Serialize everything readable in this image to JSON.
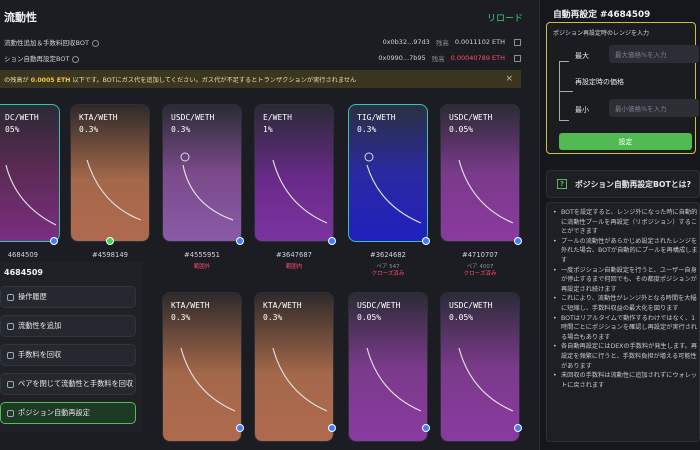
{
  "header": {
    "title": "流動性",
    "reload_label": "リロード"
  },
  "bots": [
    {
      "label": "流動性追加＆手数料回収BOT",
      "address": "0x0b32...97d3",
      "balance_label": "残高",
      "balance": "0.0011102 ETH"
    },
    {
      "label": "ション自動再設定BOT",
      "address": "0x0990...7b95",
      "balance_label": "残高",
      "balance": "0.00040789 ETH"
    }
  ],
  "warning": {
    "prefix": "の残高が ",
    "amount": "0.0005 ETH",
    "suffix": " 以下です。BOTにガス代を追加してください。ガス代が不足するとトランザクションが実行されません"
  },
  "cards_row1": [
    {
      "pair": "DC/WETH",
      "fee": "05%",
      "id": "4684509",
      "status": "",
      "selected": true
    },
    {
      "pair": "KTA/WETH",
      "fee": "0.3%",
      "id": "#4598149",
      "status": ""
    },
    {
      "pair": "USDC/WETH",
      "fee": "0.3%",
      "id": "#4555951",
      "status": "範囲外"
    },
    {
      "pair": "E/WETH",
      "fee": "1%",
      "id": "#3647687",
      "status": "範囲内"
    },
    {
      "pair": "TIG/WETH",
      "fee": "0.3%",
      "id": "#3624682",
      "status": "ペア 547"
    },
    {
      "pair": "USDC/WETH",
      "fee": "0.05%",
      "id": "#4710707",
      "status": "ペア 4007"
    }
  ],
  "cards_row1_extra": {
    "c4": "クローズ済み",
    "c5": "クローズ済み"
  },
  "cards_row2": [
    {
      "pair": "KTA/WETH",
      "fee": "0.3%"
    },
    {
      "pair": "KTA/WETH",
      "fee": "0.3%"
    },
    {
      "pair": "USDC/WETH",
      "fee": "0.05%"
    },
    {
      "pair": "USDC/WETH",
      "fee": "0.05%"
    }
  ],
  "menu": {
    "title": "4684509",
    "items": [
      "操作履歴",
      "流動性を追加",
      "手数料を回収",
      "ペアを閉じて流動性と手数料を回収",
      "ポジション自動再設定"
    ]
  },
  "settings": {
    "title": "自動再設定 #4684509",
    "caption": "ポジション再設定時のレンジを入力",
    "max_label": "最大",
    "max_placeholder": "最大価格%を入力",
    "current_label": "再設定時の価格",
    "min_label": "最小",
    "min_placeholder": "最小価格%を入力",
    "button": "設定"
  },
  "faq": {
    "title": "ポジション自動再設定BOTとは?",
    "items": [
      "BOTを設定すると、レンジ外になった時に自動的に流動性プールを再設定（リポジション）することができます",
      "プールの流動性があらかじめ設定されたレンジを外れた場合、BOTが自動的にプールを再構成します",
      "一度ポジション自動設定を行うと、ユーザー自身が停止するまで何回でも、その都度ポジションが再設定され続けます",
      "これにより、流動性がレンジ外となる時間を大幅に短縮し、手数料収益の最大化を図ります",
      "BOTはリアルタイムで動作するわけではなく、1時間ごとにポジションを確認し再設定が実行される場合もあります",
      "各自動再設定にはDEXの手数料が発生します。再設定を頻繁に行うと、手数料負担が増える可能性があります",
      "未回収の手数料は流動性に追加されずにウォレットに戻されます"
    ]
  },
  "colors": {
    "accent": "#52ba52",
    "warning": "#c9c23a",
    "alert": "#ff4d6a"
  }
}
